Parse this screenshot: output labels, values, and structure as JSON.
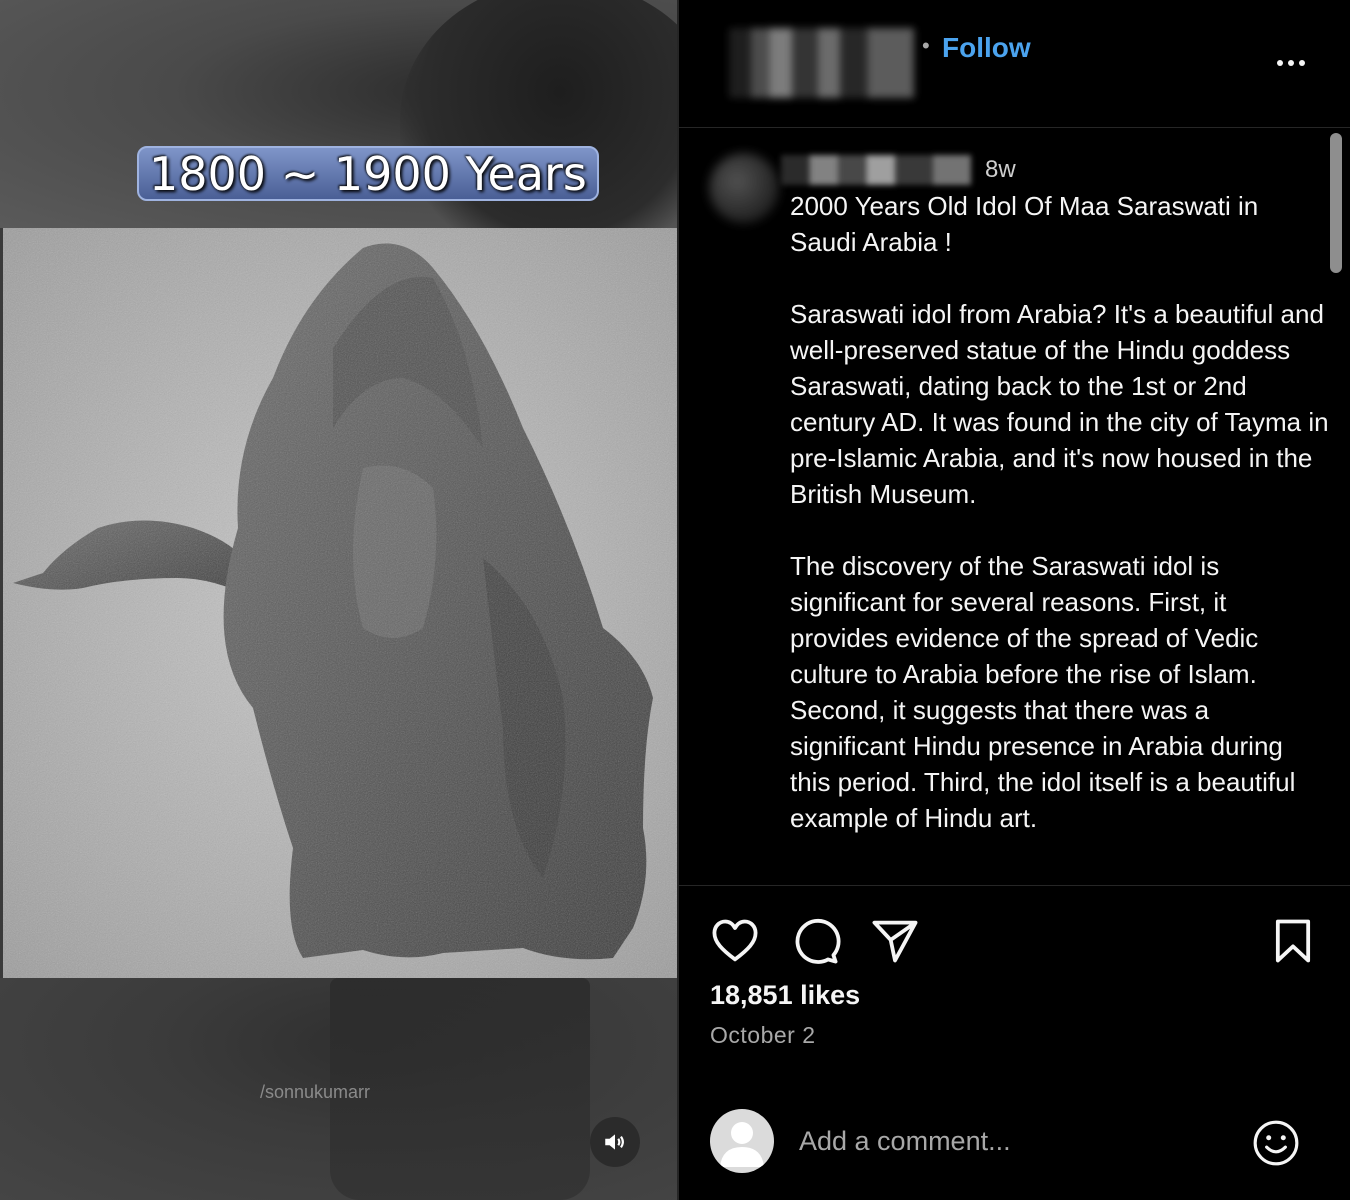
{
  "media": {
    "overlay_caption": "1800 ~ 1900 Years",
    "watermark": "/sonnukumarr",
    "audio_icon": "speaker-icon"
  },
  "header": {
    "separator": "•",
    "follow_label": "Follow",
    "more_icon": "more-options-icon"
  },
  "post": {
    "time_ago": "8w",
    "caption": "2000 Years Old Idol Of Maa Saraswati in Saudi Arabia !\n\nSaraswati idol from Arabia? It's a beautiful and well-preserved statue of the Hindu goddess Saraswati, dating back to the 1st or 2nd century AD. It was found in the city of Tayma in pre-Islamic Arabia, and it's now housed in the British Museum.\n\nThe discovery of the Saraswati idol is significant for several reasons. First, it provides evidence of the spread of Vedic culture to Arabia before the rise of Islam. Second, it suggests that there was a significant Hindu presence in Arabia during this period. Third, the idol itself is a beautiful example of Hindu art.",
    "likes": "18,851 likes",
    "date": "October 2"
  },
  "actions": {
    "like_icon": "heart-icon",
    "comment_icon": "comment-icon",
    "share_icon": "share-icon",
    "save_icon": "bookmark-icon"
  },
  "comment": {
    "placeholder": "Add a comment...",
    "emoji_icon": "emoji-icon"
  },
  "colors": {
    "background": "#000000",
    "accent": "#4ba3ee",
    "muted_text": "#a8a8a8"
  }
}
